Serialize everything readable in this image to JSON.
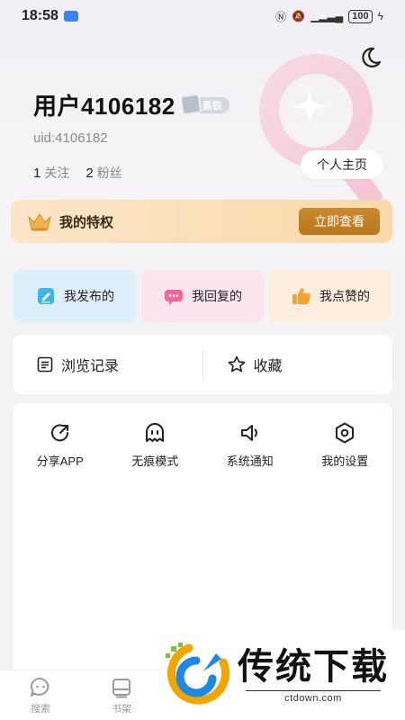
{
  "status_bar": {
    "time": "18:58",
    "battery": "100"
  },
  "profile": {
    "username": "用户4106182",
    "level_badge": "黑铁",
    "uid": "uid:4106182",
    "following_count": "1",
    "following_label": "关注",
    "fans_count": "2",
    "fans_label": "粉丝",
    "homepage_button": "个人主页"
  },
  "privilege": {
    "title": "我的特权",
    "button": "立即查看"
  },
  "quick_actions": [
    {
      "label": "我发布的",
      "icon": "edit-note-icon",
      "color": "#3db5e8"
    },
    {
      "label": "我回复的",
      "icon": "chat-bubble-icon",
      "color": "#f0659b"
    },
    {
      "label": "我点赞的",
      "icon": "thumbs-up-icon",
      "color": "#f4a333"
    }
  ],
  "history_card": {
    "history": "浏览记录",
    "favorites": "收藏"
  },
  "tools": [
    {
      "label": "分享APP",
      "icon": "share-icon"
    },
    {
      "label": "无痕模式",
      "icon": "ghost-icon"
    },
    {
      "label": "系统通知",
      "icon": "speaker-icon"
    },
    {
      "label": "我的设置",
      "icon": "settings-hex-icon"
    }
  ],
  "tabbar": [
    {
      "label": "搜索",
      "icon": "chat-search-icon"
    },
    {
      "label": "书架",
      "icon": "bookshelf-icon"
    }
  ],
  "watermark": {
    "title": "传统下载",
    "url": "ctdown.com"
  }
}
